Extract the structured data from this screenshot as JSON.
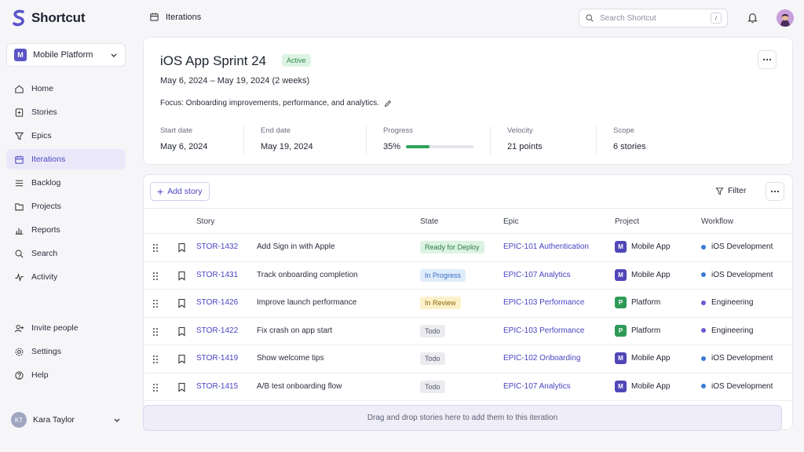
{
  "app": {
    "name": "Shortcut",
    "brand_color": "#5b55c7"
  },
  "workspace": {
    "badge": "M",
    "name": "Mobile Platform"
  },
  "nav": [
    {
      "label": "Home",
      "icon": "home-icon"
    },
    {
      "label": "Stories",
      "icon": "stories-icon"
    },
    {
      "label": "Epics",
      "icon": "epics-icon"
    },
    {
      "label": "Iterations",
      "icon": "calendar-icon",
      "active": true
    },
    {
      "label": "Backlog",
      "icon": "backlog-icon"
    },
    {
      "label": "Projects",
      "icon": "folder-icon"
    },
    {
      "label": "Reports",
      "icon": "chart-icon"
    },
    {
      "label": "Search",
      "icon": "search-icon"
    },
    {
      "label": "Activity",
      "icon": "activity-icon"
    }
  ],
  "nav_bottom": [
    {
      "label": "Invite people",
      "icon": "invite-icon"
    },
    {
      "label": "Settings",
      "icon": "gear-icon"
    },
    {
      "label": "Help",
      "icon": "help-icon"
    }
  ],
  "user": {
    "initials": "KT",
    "name": "Kara Taylor"
  },
  "header": {
    "breadcrumb": "Iterations",
    "search_placeholder": "Search Shortcut",
    "search_shortcut": "/"
  },
  "sprint": {
    "title": "iOS App Sprint 24",
    "status": "Active",
    "dates": "May 6, 2024 – May 19, 2024 (2 weeks)",
    "focus": "Focus: Onboarding improvements, performance, and analytics.",
    "stats": {
      "start_label": "Start date",
      "start_value": "May 6, 2024",
      "end_label": "End date",
      "end_value": "May 19, 2024",
      "progress_label": "Progress",
      "progress_value": "35%",
      "progress_fraction": 0.35,
      "velocity_label": "Velocity",
      "velocity_value": "21 points",
      "scope_label": "Scope",
      "scope_value": "6 stories"
    }
  },
  "toolbar": {
    "add_story": "Add story",
    "filter": "Filter"
  },
  "table": {
    "headers": {
      "story": "Story",
      "state": "State",
      "epic": "Epic",
      "project": "Project",
      "workflow": "Workflow"
    },
    "rows": [
      {
        "id": "STOR-1432",
        "title": "Add Sign in with Apple",
        "state": "Ready for Deploy",
        "state_kind": "deploy",
        "epic": "EPIC-101 Authentication",
        "project_badge": "M",
        "project": "Mobile App",
        "workflow": "iOS Development"
      },
      {
        "id": "STOR-1431",
        "title": "Track onboarding completion",
        "state": "In Progress",
        "state_kind": "progress",
        "epic": "EPIC-107 Analytics",
        "project_badge": "M",
        "project": "Mobile App",
        "workflow": "iOS Development"
      },
      {
        "id": "STOR-1426",
        "title": "Improve launch performance",
        "state": "In Review",
        "state_kind": "review",
        "epic": "EPIC-103 Performance",
        "project_badge": "P",
        "project": "Platform",
        "workflow": "Engineering"
      },
      {
        "id": "STOR-1422",
        "title": "Fix crash on app start",
        "state": "Todo",
        "state_kind": "todo",
        "epic": "EPIC-103 Performance",
        "project_badge": "P",
        "project": "Platform",
        "workflow": "Engineering"
      },
      {
        "id": "STOR-1419",
        "title": "Show welcome tips",
        "state": "Todo",
        "state_kind": "todo",
        "epic": "EPIC-102 Onboarding",
        "project_badge": "M",
        "project": "Mobile App",
        "workflow": "iOS Development"
      },
      {
        "id": "STOR-1415",
        "title": "A/B test onboarding flow",
        "state": "Todo",
        "state_kind": "todo",
        "epic": "EPIC-107 Analytics",
        "project_badge": "M",
        "project": "Mobile App",
        "workflow": "iOS Development"
      }
    ]
  },
  "dropzone": "Drag and drop stories here to add them to this iteration",
  "colors": {
    "deploy_bg": "#dcf3e3",
    "deploy_fg": "#2f7a4a",
    "progress_bg": "#e0ecfb",
    "progress_fg": "#3a6fc4",
    "review_bg": "#fdf1c9",
    "review_fg": "#8a6a10",
    "todo_bg": "#ececf0",
    "todo_fg": "#555a6b",
    "mobile_badge": "#4f47b8",
    "platform_badge": "#2f9a57",
    "ios_dot": "#3a7bd5",
    "eng_dot": "#6b5bd0"
  }
}
